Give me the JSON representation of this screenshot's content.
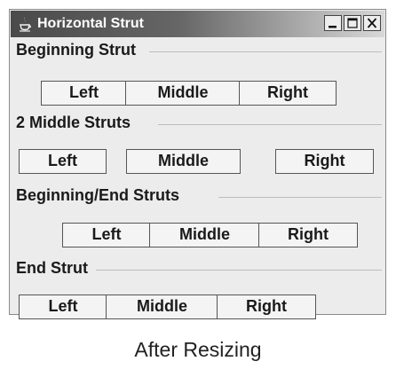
{
  "window": {
    "title": "Horizontal Strut",
    "controls": {
      "minimize": "minimize",
      "maximize": "maximize",
      "close": "close"
    }
  },
  "groups": [
    {
      "label": "Beginning Strut",
      "buttons": [
        "Left",
        "Middle",
        "Right"
      ]
    },
    {
      "label": "2 Middle Struts",
      "buttons": [
        "Left",
        "Middle",
        "Right"
      ]
    },
    {
      "label": "Beginning/End Struts",
      "buttons": [
        "Left",
        "Middle",
        "Right"
      ]
    },
    {
      "label": "End Strut",
      "buttons": [
        "Left",
        "Middle",
        "Right"
      ]
    }
  ],
  "caption": "After Resizing"
}
